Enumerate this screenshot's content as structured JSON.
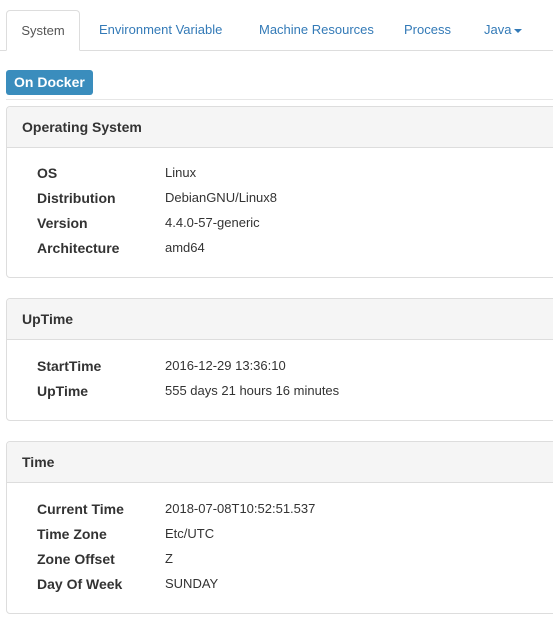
{
  "tabs": {
    "system": "System",
    "environment_variable": "Environment Variable",
    "machine_resources": "Machine Resources",
    "process": "Process",
    "java": "Java"
  },
  "badge": "On Docker",
  "panels": {
    "os": {
      "title": "Operating System",
      "rows": [
        {
          "key": "OS",
          "value": "Linux"
        },
        {
          "key": "Distribution",
          "value": "DebianGNU/Linux8"
        },
        {
          "key": "Version",
          "value": "4.4.0-57-generic"
        },
        {
          "key": "Architecture",
          "value": "amd64"
        }
      ]
    },
    "uptime": {
      "title": "UpTime",
      "rows": [
        {
          "key": "StartTime",
          "value": "2016-12-29 13:36:10"
        },
        {
          "key": "UpTime",
          "value": "555 days 21 hours 16 minutes"
        }
      ]
    },
    "time": {
      "title": "Time",
      "rows": [
        {
          "key": "Current Time",
          "value": "2018-07-08T10:52:51.537"
        },
        {
          "key": "Time Zone",
          "value": "Etc/UTC"
        },
        {
          "key": "Zone Offset",
          "value": "Z"
        },
        {
          "key": "Day Of Week",
          "value": "SUNDAY"
        }
      ]
    }
  },
  "colors": {
    "link": "#337ab7",
    "badge": "#3a8dbd",
    "panel_heading_bg": "#f5f5f5",
    "border": "#dddddd"
  }
}
